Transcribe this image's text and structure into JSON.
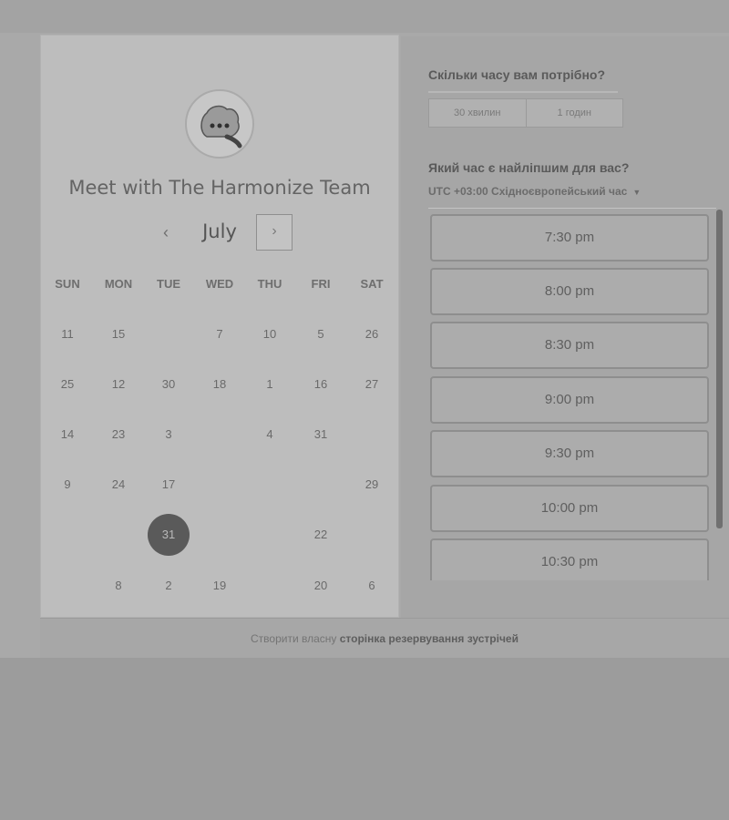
{
  "booking": {
    "title": "Meet with The Harmonize Team",
    "month": "July",
    "nav_prev": "‹",
    "nav_next": "›",
    "weekdays": [
      "SUN",
      "MON",
      "TUE",
      "WED",
      "THU",
      "FRI",
      "SAT"
    ],
    "days": [
      [
        "11",
        "15",
        "",
        "7",
        "10",
        "5",
        "26"
      ],
      [
        "25",
        "12",
        "30",
        "18",
        "1",
        "16",
        "27"
      ],
      [
        "14",
        "23",
        "3",
        "",
        "4",
        "31",
        ""
      ],
      [
        "9",
        "24",
        "17",
        "",
        "",
        "",
        "29"
      ],
      [
        "",
        "",
        "31",
        "",
        "",
        "22",
        ""
      ],
      [
        "",
        "8",
        "2",
        "19",
        "",
        "20",
        "6"
      ]
    ],
    "selected_day": "31"
  },
  "duration": {
    "heading": "Скільки часу вам потрібно?",
    "options": [
      "30 хвилин",
      "1 годин"
    ]
  },
  "time": {
    "heading": "Який час є найліпшим для вас?",
    "timezone": "UTC +03:00 Східноєвропейський час",
    "slots": [
      "7:30 pm",
      "8:00 pm",
      "8:30 pm",
      "9:00 pm",
      "9:30 pm",
      "10:00 pm",
      "10:30 pm"
    ]
  },
  "footer": {
    "prefix": "Створити власну",
    "link": "сторінка резервування зустрічей"
  },
  "colors": {
    "selected_day": "#5a5a5a",
    "card": "#bdbdbd"
  }
}
